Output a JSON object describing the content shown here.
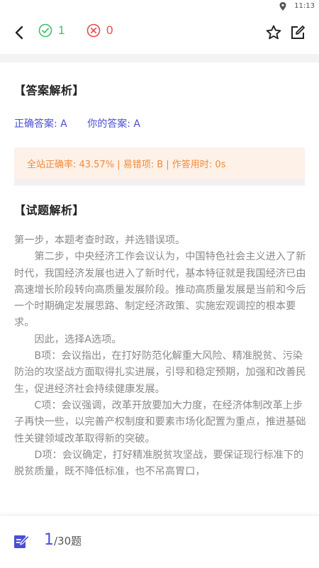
{
  "status": {
    "time": "11:13"
  },
  "header": {
    "correct_count": "1",
    "wrong_count": "0"
  },
  "answer_section": {
    "title": "【答案解析】",
    "correct_answer": "正确答案: A",
    "your_answer": "你的答案: A"
  },
  "stats": {
    "text": "全站正确率: 43.57% | 易错项: B | 作答用时: 0s"
  },
  "question_section": {
    "title": "【试题解析】",
    "paragraphs": [
      "第一步，本题考查时政，并选错误项。",
      "第二步，中央经济工作会议认为，中国特色社会主义进入了新时代，我国经济发展也进入了新时代，基本特征就是我国经济已由高速增长阶段转向高质量发展阶段。推动高质量发展是当前和今后一个时期确定发展思路、制定经济政策、实施宏观调控的根本要求。",
      "因此，选择A选项。",
      "B项：会议指出，在打好防范化解重大风险、精准脱贫、污染防治的攻坚战方面取得扎实进展，引导和稳定预期，加强和改善民生，促进经济社会持续健康发展。",
      "C项：会议强调，改革开放要加大力度，在经济体制改革上步子再快一些，以完善产权制度和要素市场化配置为重点，推进基础性关键领域改革取得新的突破。",
      "D项：会议确定，打好精准脱贫攻坚战，要保证现行标准下的脱贫质量，既不降低标准，也不吊高胃口，"
    ]
  },
  "footer": {
    "current": "1",
    "total": "/30题"
  },
  "colors": {
    "accent": "#4a4fd0",
    "correct": "#3fbf6b",
    "wrong": "#e84a4a",
    "stats_text": "#f08a3a",
    "stats_bg": "#fdf1e8"
  }
}
